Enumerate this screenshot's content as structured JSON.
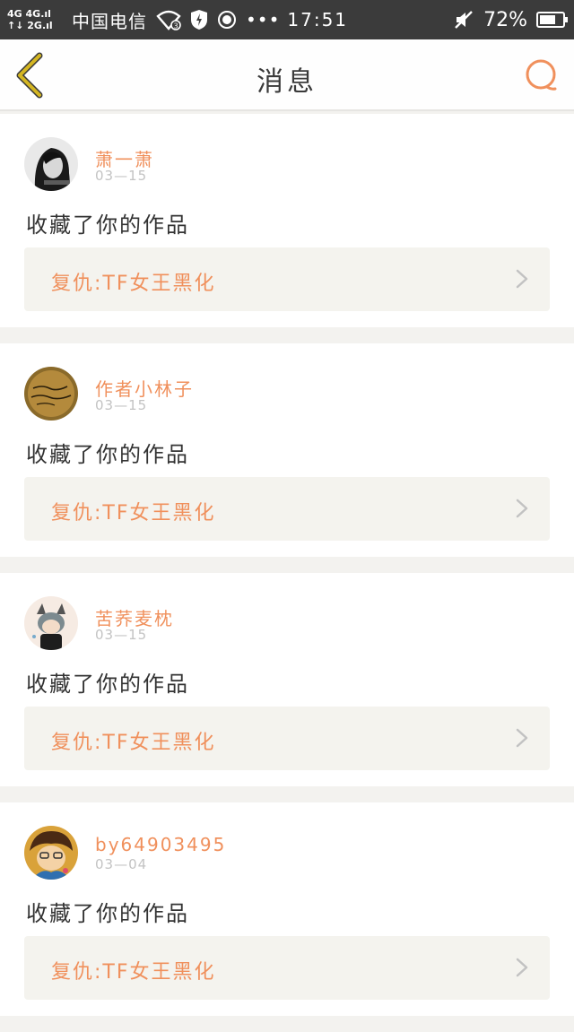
{
  "status_bar": {
    "net_line1": "4G 4G.ıl",
    "net_line2": "↑↓ 2G.ıl",
    "carrier": "中国电信",
    "dots": "•••",
    "time": "17:51",
    "battery_percent": "72%",
    "battery_level": 0.72
  },
  "header": {
    "title": "消息",
    "back_icon": "chevron-left-icon",
    "search_icon": "search-icon"
  },
  "colors": {
    "accent": "#f0905c",
    "back_icon": "#d4b622",
    "search_icon": "#f0905c"
  },
  "messages": [
    {
      "username": "萧一萧",
      "date": "03—15",
      "action": "收藏了你的作品",
      "work_title": "复仇:TF女王黑化"
    },
    {
      "username": "作者小林子",
      "date": "03—15",
      "action": "收藏了你的作品",
      "work_title": "复仇:TF女王黑化"
    },
    {
      "username": "苦荞麦枕",
      "date": "03—15",
      "action": "收藏了你的作品",
      "work_title": "复仇:TF女王黑化"
    },
    {
      "username": "by64903495",
      "date": "03—04",
      "action": "收藏了你的作品",
      "work_title": "复仇:TF女王黑化"
    }
  ]
}
